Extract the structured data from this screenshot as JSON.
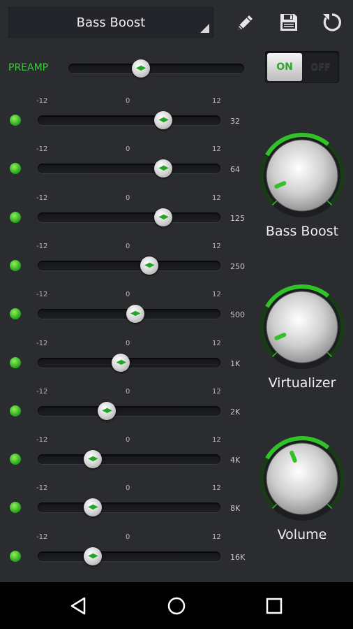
{
  "preset": {
    "name": "Bass Boost"
  },
  "toolbar": {
    "edit_icon": "pencil-icon",
    "save_icon": "save-icon",
    "reset_icon": "reset-icon"
  },
  "preamp": {
    "label": "PREAMP",
    "level": 0.41
  },
  "power": {
    "on_label": "ON",
    "off_label": "OFF",
    "state": "on"
  },
  "scale": {
    "min": "-12",
    "mid": "0",
    "max": "12"
  },
  "bands": [
    {
      "freq": "32",
      "value": 5.0
    },
    {
      "freq": "64",
      "value": 5.0
    },
    {
      "freq": "125",
      "value": 5.0
    },
    {
      "freq": "250",
      "value": 3.0
    },
    {
      "freq": "500",
      "value": 1.0
    },
    {
      "freq": "1K",
      "value": -1.0
    },
    {
      "freq": "2K",
      "value": -3.0
    },
    {
      "freq": "4K",
      "value": -5.0
    },
    {
      "freq": "8K",
      "value": -5.0
    },
    {
      "freq": "16K",
      "value": -5.0
    }
  ],
  "knobs": [
    {
      "label": "Bass Boost",
      "level": 0.08
    },
    {
      "label": "Virtualizer",
      "level": 0.08
    },
    {
      "label": "Volume",
      "level": 0.42
    }
  ],
  "colors": {
    "accent": "#33c12a",
    "background": "#2b2c30"
  },
  "nav": {
    "back_icon": "back-triangle-icon",
    "home_icon": "home-circle-icon",
    "recents_icon": "recents-square-icon"
  }
}
